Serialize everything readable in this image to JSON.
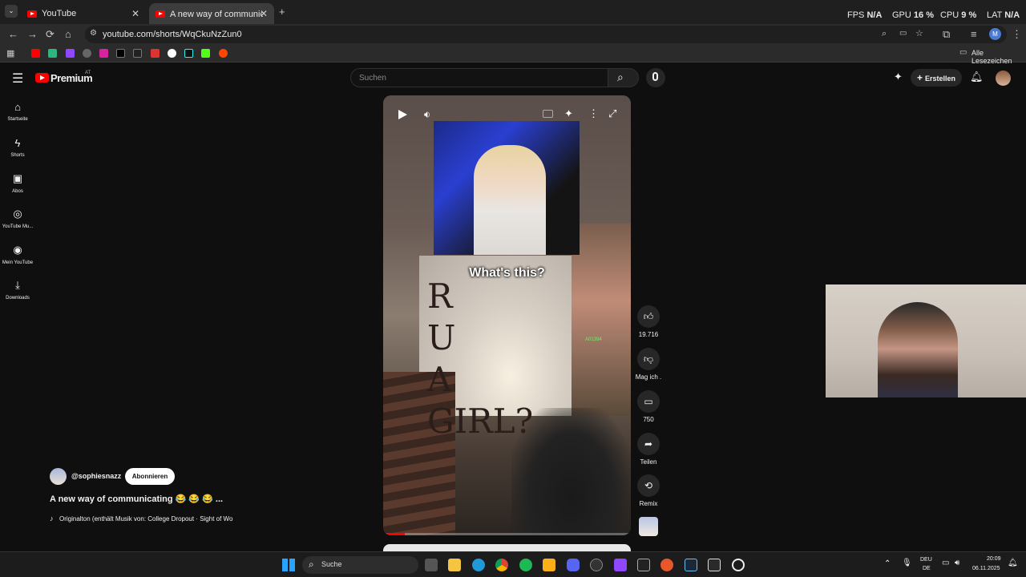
{
  "browser": {
    "tabs": [
      {
        "title": "YouTube",
        "active": false
      },
      {
        "title": "A new way of communicating 🤦",
        "active": true
      }
    ],
    "url": "youtube.com/shorts/WqCkuNzZun0",
    "bookmarks_label": "Alle Lesezeichen",
    "profile_letter": "M"
  },
  "overlay": {
    "fps_label": "FPS",
    "fps_value": "N/A",
    "gpu_label": "GPU",
    "gpu_value": "16 %",
    "cpu_label": "CPU",
    "cpu_value": "9 %",
    "lat_label": "LAT",
    "lat_value": "N/A"
  },
  "youtube": {
    "logo_text": "Premium",
    "region": "AT",
    "search_placeholder": "Suchen",
    "create_label": "Erstellen",
    "sidebar": [
      {
        "label": "Startseite",
        "icon": "home-icon"
      },
      {
        "label": "Shorts",
        "icon": "shorts-icon"
      },
      {
        "label": "Abos",
        "icon": "subscriptions-icon"
      },
      {
        "label": "YouTube Mu...",
        "icon": "music-icon"
      },
      {
        "label": "Mein YouTube",
        "icon": "account-icon"
      },
      {
        "label": "Downloads",
        "icon": "download-icon"
      }
    ],
    "video": {
      "caption": "What's this?",
      "wall_text": "R U A GIRL?",
      "player_tag": "A01394",
      "channel": "@sophiesnazz",
      "subscribe_label": "Abonnieren",
      "title": "A new way of communicating 😂 😂 😂 ...",
      "audio": "Originalton (enthält Musik von: College Dropout · Sight of Wo"
    },
    "actions": {
      "likes": "19.716",
      "dislike": "Mag ich .",
      "comments": "750",
      "share": "Teilen",
      "remix": "Remix"
    }
  },
  "taskbar": {
    "search_label": "Suche",
    "lang1": "DEU",
    "lang2": "DE",
    "time": "20:09",
    "date": "06.11.2025"
  },
  "colors": {
    "accent": "#ff0000",
    "bg": "#0f0f0f"
  }
}
